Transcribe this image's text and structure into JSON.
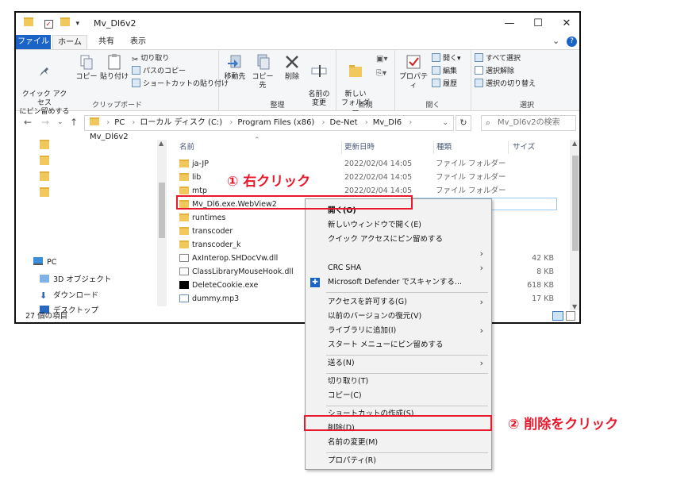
{
  "window": {
    "title": "Mv_Dl6v2",
    "minimize": "—",
    "maximize": "☐",
    "close": "✕"
  },
  "tabs": {
    "file": "ファイル",
    "home": "ホーム",
    "share": "共有",
    "view": "表示"
  },
  "ribbon": {
    "clipboard": {
      "label": "クリップボード",
      "pin": "クイック アクセス\nにピン留めする",
      "copy": "コピー",
      "paste": "貼り付け",
      "cut": "切り取り",
      "copy_path": "パスのコピー",
      "paste_shortcut": "ショートカットの貼り付け"
    },
    "organize": {
      "label": "整理",
      "move_to": "移動先",
      "copy_to": "コピー先",
      "delete": "削除",
      "rename": "名前の\n変更"
    },
    "new": {
      "label": "新規",
      "new_folder": "新しい\nフォルダー"
    },
    "open": {
      "label": "開く",
      "properties": "プロパティ",
      "open": "開く",
      "edit": "編集",
      "history": "履歴"
    },
    "select": {
      "label": "選択",
      "select_all": "すべて選択",
      "select_none": "選択解除",
      "invert": "選択の切り替え"
    }
  },
  "address": {
    "crumbs": [
      "PC",
      "ローカル ディスク (C:)",
      "Program Files (x86)",
      "De-Net",
      "Mv_Dl6",
      "Mv_Dl6v2"
    ],
    "search_placeholder": "Mv_Dl6v2の検索"
  },
  "nav": {
    "items": [
      {
        "label": "PC",
        "icon": "pc-icon"
      },
      {
        "label": "3D オブジェクト",
        "icon": "3d-objects-icon"
      },
      {
        "label": "ダウンロード",
        "icon": "download-icon"
      },
      {
        "label": "デスクトップ",
        "icon": "desktop-icon"
      }
    ]
  },
  "columns": {
    "name": "名前",
    "date": "更新日時",
    "type": "種類",
    "size": "サイズ"
  },
  "files": [
    {
      "name": "ja-JP",
      "date": "2022/02/04 14:05",
      "type": "ファイル フォルダー",
      "size": "",
      "icon": "folder"
    },
    {
      "name": "lib",
      "date": "2022/02/04 14:05",
      "type": "ファイル フォルダー",
      "size": "",
      "icon": "folder"
    },
    {
      "name": "mtp",
      "date": "2022/02/04 14:05",
      "type": "ファイル フォルダー",
      "size": "",
      "icon": "folder"
    },
    {
      "name": "Mv_Dl6.exe.WebView2",
      "date": "",
      "type": "",
      "size": "",
      "icon": "folder"
    },
    {
      "name": "runtimes",
      "date": "",
      "type": "",
      "size": "",
      "icon": "folder"
    },
    {
      "name": "transcoder",
      "date": "",
      "type": "",
      "size": "",
      "icon": "folder"
    },
    {
      "name": "transcoder_k",
      "date": "",
      "type": "",
      "size": "",
      "icon": "folder"
    },
    {
      "name": "AxInterop.SHDocVw.dll",
      "date": "",
      "type": "",
      "size": "42 KB",
      "icon": "doc"
    },
    {
      "name": "ClassLibraryMouseHook.dll",
      "date": "",
      "type": "",
      "size": "8 KB",
      "icon": "doc"
    },
    {
      "name": "DeleteCookie.exe",
      "date": "",
      "type": "",
      "size": "618 KB",
      "icon": "exe"
    },
    {
      "name": "dummy.mp3",
      "date": "",
      "type": "",
      "size": "17 KB",
      "icon": "mp3"
    }
  ],
  "status": {
    "count": "27 個の項目"
  },
  "context_menu": {
    "open": "開く(O)",
    "open_new_window": "新しいウィンドウで開く(E)",
    "pin_quick_access": "クイック アクセスにピン留めする",
    "crc_sha": "CRC SHA",
    "defender": "Microsoft Defender でスキャンする...",
    "give_access": "アクセスを許可する(G)",
    "restore_versions": "以前のバージョンの復元(V)",
    "add_library": "ライブラリに追加(I)",
    "pin_start": "スタート メニューにピン留めする",
    "send_to": "送る(N)",
    "cut": "切り取り(T)",
    "copy": "コピー(C)",
    "create_shortcut": "ショートカットの作成(S)",
    "delete": "削除(D)",
    "rename": "名前の変更(M)",
    "properties": "プロパティ(R)"
  },
  "annotations": {
    "right_click": "① 右クリック",
    "click_delete": "② 削除をクリック"
  },
  "colors": {
    "annotation_red": "#e8192c",
    "file_tab_blue": "#1a64c8",
    "folder_yellow": "#f0c85b"
  }
}
